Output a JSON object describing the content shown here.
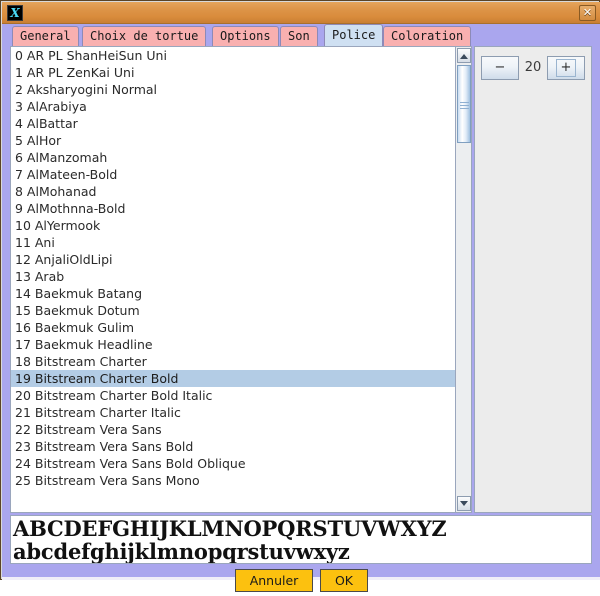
{
  "window": {
    "app_icon": "x-app-icon",
    "icon_glyph": "X",
    "close_glyph": "✕",
    "title": ""
  },
  "colors": {
    "titlebar": "#dd9448",
    "frame_border": "#5a4326",
    "panel_background": "#aaa6ee",
    "tab_unselected": "#f9b0b0",
    "tab_selected": "#cfe0f2",
    "list_selection": "#b3cce5",
    "button_accent": "#fcc10f",
    "size_panel_background": "#ececec"
  },
  "tabs": [
    {
      "label": "General",
      "selected": false
    },
    {
      "label": "Choix de tortue",
      "selected": false
    },
    {
      "label": "Options",
      "selected": false
    },
    {
      "label": "Son",
      "selected": false
    },
    {
      "label": "Police",
      "selected": true
    },
    {
      "label": "Coloration",
      "selected": false
    }
  ],
  "font_list": {
    "selected_index": 19,
    "items": [
      "0 AR PL ShanHeiSun Uni",
      "1 AR PL ZenKai Uni",
      "2 Aksharyogini Normal",
      "3 AlArabiya",
      "4 AlBattar",
      "5 AlHor",
      "6 AlManzomah",
      "7 AlMateen-Bold",
      "8 AlMohanad",
      "9 AlMothnna-Bold",
      "10 AlYermook",
      "11 Ani",
      "12 AnjaliOldLipi",
      "13 Arab",
      "14 Baekmuk Batang",
      "15 Baekmuk Dotum",
      "16 Baekmuk Gulim",
      "17 Baekmuk Headline",
      "18 Bitstream Charter",
      "19 Bitstream Charter Bold",
      "20 Bitstream Charter Bold Italic",
      "21 Bitstream Charter Italic",
      "22 Bitstream Vera Sans",
      "23 Bitstream Vera Sans Bold",
      "24 Bitstream Vera Sans Bold Oblique",
      "25 Bitstream Vera Sans Mono"
    ]
  },
  "scrollbar": {
    "up_arrow": "scroll-up-icon",
    "down_arrow": "scroll-down-icon"
  },
  "size_control": {
    "decrease_label": "−",
    "value": "20",
    "increase_label": "+"
  },
  "preview": {
    "uppercase": "ABCDEFGHIJKLMNOPQRSTUVWXYZ",
    "lowercase": "abcdefghijklmnopqrstuvwxyz"
  },
  "buttons": {
    "cancel_label": "Annuler",
    "ok_label": "OK"
  }
}
